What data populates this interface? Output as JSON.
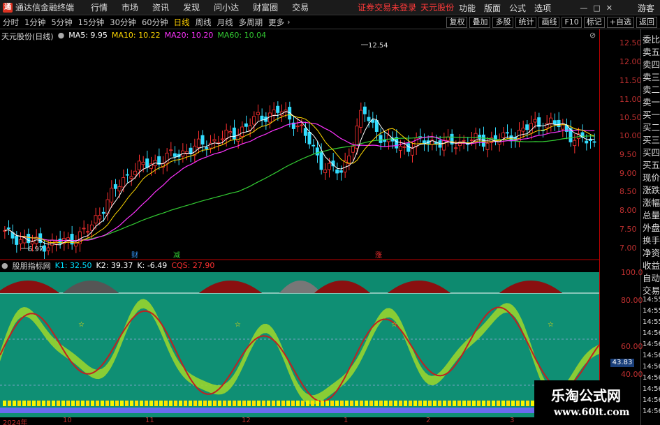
{
  "window": {
    "title": "通达信金融终端",
    "menu": [
      "行情",
      "市场",
      "资讯",
      "发现",
      "问小达",
      "财富圈",
      "交易"
    ],
    "notice": "证券交易未登录",
    "stock": "天元股份",
    "right_menu": [
      "功能",
      "版面",
      "公式",
      "选项"
    ],
    "guest": "游客"
  },
  "toolbar": {
    "periods": [
      "分时",
      "1分钟",
      "5分钟",
      "15分钟",
      "30分钟",
      "60分钟",
      "日线",
      "周线",
      "月线",
      "多周期",
      "更多"
    ],
    "active": "日线",
    "tools": [
      "复权",
      "叠加",
      "多股",
      "统计",
      "画线",
      "F10",
      "标记",
      "+自选",
      "返回"
    ]
  },
  "main_chart": {
    "name": "天元股份(日线)",
    "ma5": "MA5: 9.95",
    "ma10": "MA10: 10.22",
    "ma20": "MA20: 10.20",
    "ma60": "MA60: 10.04",
    "high_label": "12.54",
    "low_label": "6.97",
    "markers": [
      "财",
      "减",
      "涨"
    ]
  },
  "price_axis": [
    "12.50",
    "12.00",
    "11.50",
    "11.00",
    "10.50",
    "10.00",
    "9.50",
    "9.00",
    "8.50",
    "8.00",
    "7.50",
    "7.00"
  ],
  "right_panel": [
    "委比",
    "卖五",
    "卖四",
    "卖三",
    "卖二",
    "卖一",
    "买一",
    "买二",
    "买三",
    "买四",
    "买五",
    "现价",
    "涨跌",
    "涨幅",
    "总量",
    "外盘",
    "换手",
    "净资",
    "收益",
    "自动",
    "交易",
    "14:55",
    "14:55",
    "14:55",
    "14:56",
    "14:56",
    "14:56",
    "14:56",
    "14:56",
    "14:56",
    "14:56",
    "14:56"
  ],
  "indicator": {
    "name": "股朋指标网",
    "k1": "K1: 32.50",
    "k2": "K2: 39.37",
    "k": "K: -6.49",
    "cqs": "CQS: 27.90",
    "axis": [
      "100.0",
      "80.00",
      "60.00",
      "40.00"
    ],
    "current": "43.83"
  },
  "x_axis": [
    "2024年",
    "10",
    "11",
    "12",
    "1",
    "2",
    "3"
  ],
  "watermark": {
    "line1": "乐淘公式网",
    "line2": "www.60lt.com"
  },
  "chart_data": {
    "type": "candlestick",
    "x_labels": [
      "2024年",
      "10",
      "11",
      "12",
      "1",
      "2",
      "3"
    ],
    "ylim": [
      6.8,
      12.8
    ],
    "close_estimates": [
      7.5,
      7.3,
      7.2,
      7.3,
      7.6,
      8.5,
      9.2,
      9.4,
      9.6,
      9.8,
      10.0,
      10.2,
      10.6,
      10.8,
      10.4,
      9.4,
      9.1,
      10.8,
      10.0,
      9.8,
      10.0,
      9.9,
      10.0,
      10.0,
      10.1,
      10.4,
      10.5,
      10.1,
      9.9
    ],
    "indicator_ylim": [
      20,
      100
    ]
  }
}
